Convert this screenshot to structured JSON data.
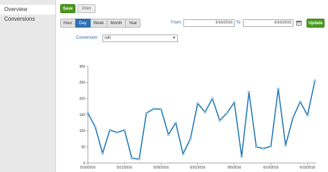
{
  "sidebar": {
    "items": [
      {
        "label": "Overview"
      },
      {
        "label": "Conversions"
      }
    ]
  },
  "toolbar": {
    "save_label": "Save",
    "print_label": "Print",
    "update_label": "Update"
  },
  "range": {
    "tabs": [
      "Hour",
      "Day",
      "Week",
      "Month",
      "Year"
    ],
    "active": "Day"
  },
  "dates": {
    "from_label": "From:",
    "from_value": "5/16/2016",
    "to_label": "To:",
    "to_value": "6/16/2016"
  },
  "filter": {
    "label": "Conversion:",
    "value": "(all)"
  },
  "colors": {
    "accent": "#2f6fb6",
    "line": "#1f78b4",
    "button_green": "#4b9a1f"
  },
  "chart_data": {
    "type": "line",
    "x": [
      "5/16/2016",
      "5/17/2016",
      "5/18/2016",
      "5/19/2016",
      "5/20/2016",
      "5/21/2016",
      "5/22/2016",
      "5/23/2016",
      "5/24/2016",
      "5/25/2016",
      "5/26/2016",
      "5/27/2016",
      "5/28/2016",
      "5/29/2016",
      "5/30/2016",
      "5/31/2016",
      "6/1/2016",
      "6/2/2016",
      "6/3/2016",
      "6/4/2016",
      "6/5/2016",
      "6/6/2016",
      "6/7/2016",
      "6/8/2016",
      "6/9/2016",
      "6/10/2016",
      "6/11/2016",
      "6/12/2016",
      "6/13/2016",
      "6/14/2016",
      "6/15/2016",
      "6/16/2016"
    ],
    "series": [
      {
        "values": [
          155,
          112,
          30,
          102,
          95,
          102,
          15,
          12,
          155,
          168,
          167,
          88,
          125,
          28,
          75,
          185,
          158,
          200,
          132,
          155,
          188,
          20,
          220,
          50,
          45,
          52,
          230,
          55,
          140,
          190,
          148,
          255
        ]
      }
    ],
    "xtick_labels": [
      "5/16/2016",
      "5/21/2016",
      "5/26/2016",
      "5/31/2016",
      "6/5/2016",
      "6/10/2016",
      "6/15/2016"
    ],
    "xtick_index": [
      0,
      5,
      10,
      15,
      20,
      25,
      30
    ],
    "yticks": [
      0,
      50,
      100,
      150,
      200,
      250,
      300
    ],
    "ylim": [
      0,
      300
    ],
    "grid": false,
    "legend": "none",
    "title": "",
    "xlabel": "",
    "ylabel": ""
  }
}
